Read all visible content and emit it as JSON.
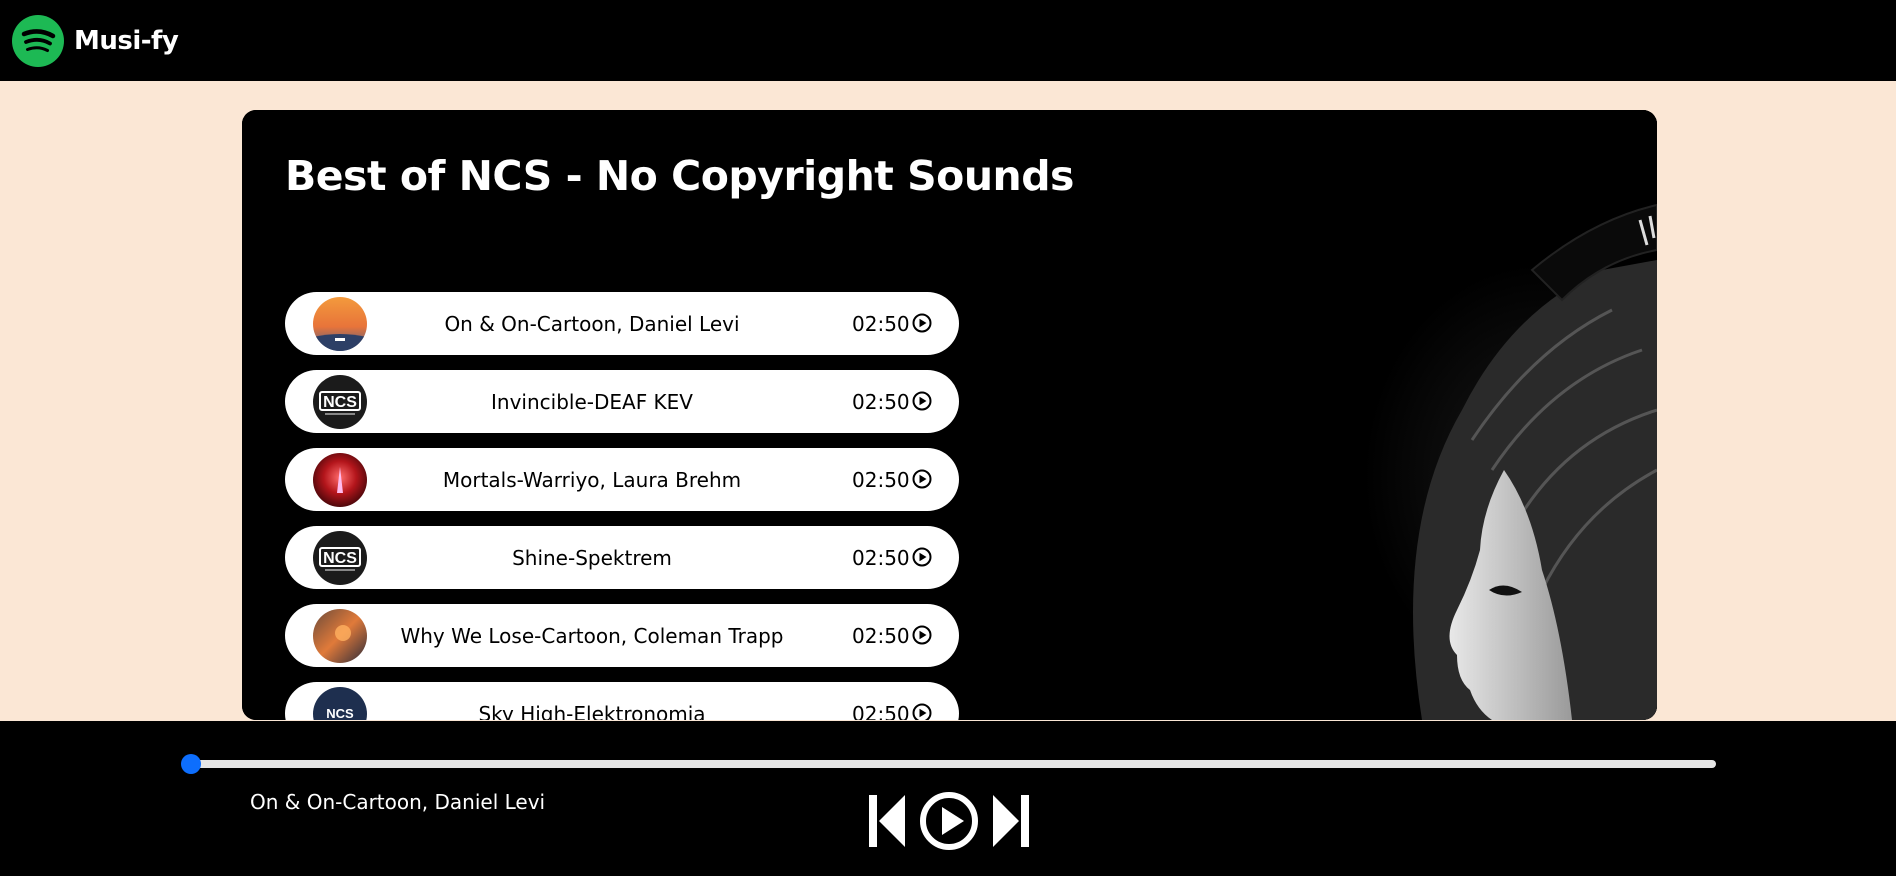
{
  "app": {
    "name": "Musi-fy",
    "logo_icon": "spotify-logo-icon"
  },
  "playlist": {
    "title": "Best of NCS - No Copyright Sounds",
    "songs": [
      {
        "name": "On & On-Cartoon, Daniel Levi",
        "duration": "02:50",
        "cover": "sunset-cover"
      },
      {
        "name": "Invincible-DEAF KEV",
        "duration": "02:50",
        "cover": "ncs-logo-cover"
      },
      {
        "name": "Mortals-Warriyo, Laura Brehm",
        "duration": "02:50",
        "cover": "red-cover"
      },
      {
        "name": "Shine-Spektrem",
        "duration": "02:50",
        "cover": "ncs-logo-cover"
      },
      {
        "name": "Why We Lose-Cartoon, Coleman Trapp",
        "duration": "02:50",
        "cover": "fire-cover"
      },
      {
        "name": "Sky High-Elektronomia",
        "duration": "02:50",
        "cover": "ncs-blue-cover"
      }
    ]
  },
  "player": {
    "now_playing": "On & On-Cartoon, Daniel Levi",
    "progress": 0.0,
    "controls": [
      "previous-icon",
      "play-icon",
      "next-icon"
    ]
  },
  "colors": {
    "page_background": "#fbe7d5",
    "bar_background": "#000000",
    "progress_accent": "#0d6efd",
    "logo_green": "#1db954"
  }
}
